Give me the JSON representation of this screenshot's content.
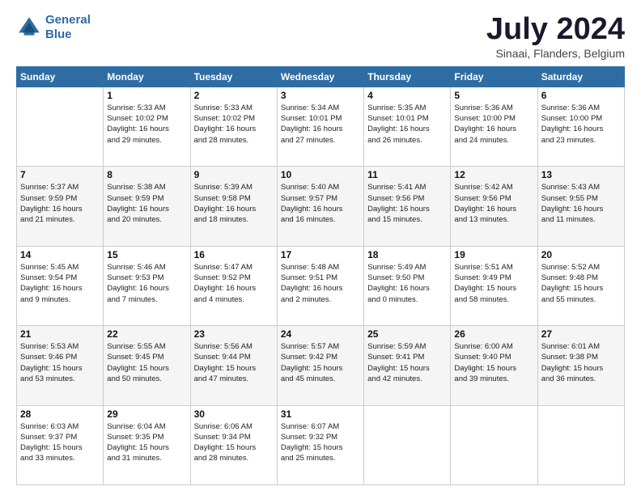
{
  "header": {
    "logo_line1": "General",
    "logo_line2": "Blue",
    "title": "July 2024",
    "subtitle": "Sinaai, Flanders, Belgium"
  },
  "days_of_week": [
    "Sunday",
    "Monday",
    "Tuesday",
    "Wednesday",
    "Thursday",
    "Friday",
    "Saturday"
  ],
  "weeks": [
    [
      {
        "day": "",
        "info": ""
      },
      {
        "day": "1",
        "info": "Sunrise: 5:33 AM\nSunset: 10:02 PM\nDaylight: 16 hours\nand 29 minutes."
      },
      {
        "day": "2",
        "info": "Sunrise: 5:33 AM\nSunset: 10:02 PM\nDaylight: 16 hours\nand 28 minutes."
      },
      {
        "day": "3",
        "info": "Sunrise: 5:34 AM\nSunset: 10:01 PM\nDaylight: 16 hours\nand 27 minutes."
      },
      {
        "day": "4",
        "info": "Sunrise: 5:35 AM\nSunset: 10:01 PM\nDaylight: 16 hours\nand 26 minutes."
      },
      {
        "day": "5",
        "info": "Sunrise: 5:36 AM\nSunset: 10:00 PM\nDaylight: 16 hours\nand 24 minutes."
      },
      {
        "day": "6",
        "info": "Sunrise: 5:36 AM\nSunset: 10:00 PM\nDaylight: 16 hours\nand 23 minutes."
      }
    ],
    [
      {
        "day": "7",
        "info": "Sunrise: 5:37 AM\nSunset: 9:59 PM\nDaylight: 16 hours\nand 21 minutes."
      },
      {
        "day": "8",
        "info": "Sunrise: 5:38 AM\nSunset: 9:59 PM\nDaylight: 16 hours\nand 20 minutes."
      },
      {
        "day": "9",
        "info": "Sunrise: 5:39 AM\nSunset: 9:58 PM\nDaylight: 16 hours\nand 18 minutes."
      },
      {
        "day": "10",
        "info": "Sunrise: 5:40 AM\nSunset: 9:57 PM\nDaylight: 16 hours\nand 16 minutes."
      },
      {
        "day": "11",
        "info": "Sunrise: 5:41 AM\nSunset: 9:56 PM\nDaylight: 16 hours\nand 15 minutes."
      },
      {
        "day": "12",
        "info": "Sunrise: 5:42 AM\nSunset: 9:56 PM\nDaylight: 16 hours\nand 13 minutes."
      },
      {
        "day": "13",
        "info": "Sunrise: 5:43 AM\nSunset: 9:55 PM\nDaylight: 16 hours\nand 11 minutes."
      }
    ],
    [
      {
        "day": "14",
        "info": "Sunrise: 5:45 AM\nSunset: 9:54 PM\nDaylight: 16 hours\nand 9 minutes."
      },
      {
        "day": "15",
        "info": "Sunrise: 5:46 AM\nSunset: 9:53 PM\nDaylight: 16 hours\nand 7 minutes."
      },
      {
        "day": "16",
        "info": "Sunrise: 5:47 AM\nSunset: 9:52 PM\nDaylight: 16 hours\nand 4 minutes."
      },
      {
        "day": "17",
        "info": "Sunrise: 5:48 AM\nSunset: 9:51 PM\nDaylight: 16 hours\nand 2 minutes."
      },
      {
        "day": "18",
        "info": "Sunrise: 5:49 AM\nSunset: 9:50 PM\nDaylight: 16 hours\nand 0 minutes."
      },
      {
        "day": "19",
        "info": "Sunrise: 5:51 AM\nSunset: 9:49 PM\nDaylight: 15 hours\nand 58 minutes."
      },
      {
        "day": "20",
        "info": "Sunrise: 5:52 AM\nSunset: 9:48 PM\nDaylight: 15 hours\nand 55 minutes."
      }
    ],
    [
      {
        "day": "21",
        "info": "Sunrise: 5:53 AM\nSunset: 9:46 PM\nDaylight: 15 hours\nand 53 minutes."
      },
      {
        "day": "22",
        "info": "Sunrise: 5:55 AM\nSunset: 9:45 PM\nDaylight: 15 hours\nand 50 minutes."
      },
      {
        "day": "23",
        "info": "Sunrise: 5:56 AM\nSunset: 9:44 PM\nDaylight: 15 hours\nand 47 minutes."
      },
      {
        "day": "24",
        "info": "Sunrise: 5:57 AM\nSunset: 9:42 PM\nDaylight: 15 hours\nand 45 minutes."
      },
      {
        "day": "25",
        "info": "Sunrise: 5:59 AM\nSunset: 9:41 PM\nDaylight: 15 hours\nand 42 minutes."
      },
      {
        "day": "26",
        "info": "Sunrise: 6:00 AM\nSunset: 9:40 PM\nDaylight: 15 hours\nand 39 minutes."
      },
      {
        "day": "27",
        "info": "Sunrise: 6:01 AM\nSunset: 9:38 PM\nDaylight: 15 hours\nand 36 minutes."
      }
    ],
    [
      {
        "day": "28",
        "info": "Sunrise: 6:03 AM\nSunset: 9:37 PM\nDaylight: 15 hours\nand 33 minutes."
      },
      {
        "day": "29",
        "info": "Sunrise: 6:04 AM\nSunset: 9:35 PM\nDaylight: 15 hours\nand 31 minutes."
      },
      {
        "day": "30",
        "info": "Sunrise: 6:06 AM\nSunset: 9:34 PM\nDaylight: 15 hours\nand 28 minutes."
      },
      {
        "day": "31",
        "info": "Sunrise: 6:07 AM\nSunset: 9:32 PM\nDaylight: 15 hours\nand 25 minutes."
      },
      {
        "day": "",
        "info": ""
      },
      {
        "day": "",
        "info": ""
      },
      {
        "day": "",
        "info": ""
      }
    ]
  ]
}
